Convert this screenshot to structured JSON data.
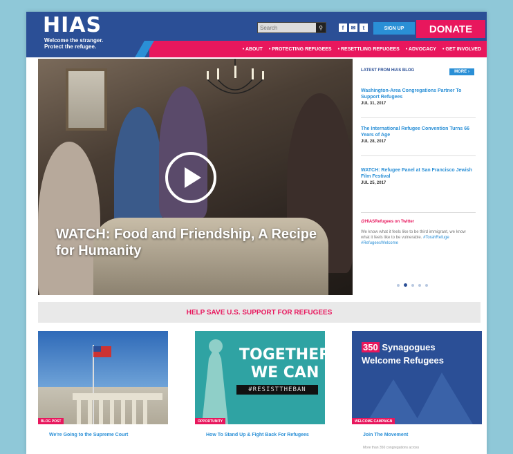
{
  "header": {
    "logo": "HIAS",
    "tagline_line1": "Welcome the stranger.",
    "tagline_line2": "Protect the refugee.",
    "search_placeholder": "Search",
    "signup_label": "SIGN UP",
    "donate_label": "DONATE",
    "nav": [
      {
        "label": "ABOUT"
      },
      {
        "label": "PROTECTING REFUGEES"
      },
      {
        "label": "RESETTLING REFUGEES"
      },
      {
        "label": "ADVOCACY"
      },
      {
        "label": "GET INVOLVED"
      }
    ]
  },
  "hero": {
    "title": "WATCH: Food and Friendship, A Recipe for Humanity"
  },
  "sidebar": {
    "blog_heading": "LATEST FROM HIAS BLOG",
    "more_label": "MORE",
    "posts": [
      {
        "title": "Washington-Area Congregations Partner To Support Refugees",
        "date": "JUL 31, 2017"
      },
      {
        "title": "The International Refugee Convention Turns 66 Years of Age",
        "date": "JUL 28, 2017"
      },
      {
        "title": "WATCH: Refugee Panel at San Francisco Jewish Film Festival",
        "date": "JUL 25, 2017"
      }
    ],
    "twitter_heading": "@HIASRefugees on Twitter",
    "tweet_text": "We know what it feels like to be third immigrant, we know what it feels like to be vulnerable.",
    "tweet_links": "#TorahRefuge #RefugeesWelcome"
  },
  "banner": {
    "text": "HELP SAVE U.S. SUPPORT FOR REFUGEES"
  },
  "cards": [
    {
      "tag": "BLOG POST",
      "title": "We're Going to the Supreme Court",
      "excerpt": ""
    },
    {
      "tag": "OPPORTUNITY",
      "title": "How To Stand Up & Fight Back For Refugees",
      "excerpt": "",
      "image_text_1": "TOGETHER",
      "image_text_2": "WE CAN",
      "image_text_3": "#RESISTTHEBAN"
    },
    {
      "tag": "WELCOME CAMPAIGN",
      "title": "Join The Movement",
      "excerpt": "More than 350 congregations across",
      "image_num": "350",
      "image_text": "Synagogues",
      "image_text_2": "Welcome Refugees"
    }
  ],
  "colors": {
    "brand_blue": "#2b4f96",
    "accent_pink": "#e8175d",
    "link_blue": "#2a8fd6"
  }
}
